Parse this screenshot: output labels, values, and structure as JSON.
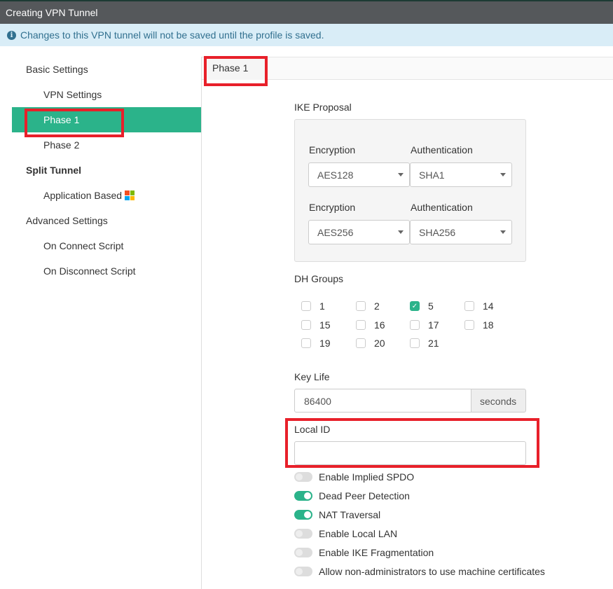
{
  "window": {
    "title": "Creating VPN Tunnel"
  },
  "info": {
    "icon": "info-circle-icon",
    "text": "Changes to this VPN tunnel will not be saved until the profile is saved."
  },
  "nav": {
    "items": [
      {
        "label": "Basic Settings"
      },
      {
        "label": "VPN Settings"
      },
      {
        "label": "Phase 1",
        "active": true
      },
      {
        "label": "Phase 2"
      },
      {
        "label": "Split Tunnel"
      },
      {
        "label": "Application Based"
      },
      {
        "label": "Advanced Settings"
      },
      {
        "label": "On Connect Script"
      },
      {
        "label": "On Disconnect Script"
      }
    ]
  },
  "tab": {
    "label": "Phase 1"
  },
  "ike": {
    "label": "IKE Proposal",
    "rows": [
      {
        "enc_label": "Encryption",
        "enc": "AES128",
        "auth_label": "Authentication",
        "auth": "SHA1"
      },
      {
        "enc_label": "Encryption",
        "enc": "AES256",
        "auth_label": "Authentication",
        "auth": "SHA256"
      }
    ]
  },
  "dh": {
    "label": "DH Groups",
    "groups": [
      {
        "v": "1",
        "c": false
      },
      {
        "v": "2",
        "c": false
      },
      {
        "v": "5",
        "c": true
      },
      {
        "v": "14",
        "c": false
      },
      {
        "v": "15",
        "c": false
      },
      {
        "v": "16",
        "c": false
      },
      {
        "v": "17",
        "c": false
      },
      {
        "v": "18",
        "c": false
      },
      {
        "v": "19",
        "c": false
      },
      {
        "v": "20",
        "c": false
      },
      {
        "v": "21",
        "c": false
      }
    ]
  },
  "keylife": {
    "label": "Key Life",
    "value": "86400",
    "unit": "seconds"
  },
  "localid": {
    "label": "Local ID",
    "value": ""
  },
  "toggles": [
    {
      "label": "Enable Implied SPDO",
      "on": false
    },
    {
      "label": "Dead Peer Detection",
      "on": true
    },
    {
      "label": "NAT Traversal",
      "on": true
    },
    {
      "label": "Enable Local LAN",
      "on": false
    },
    {
      "label": "Enable IKE Fragmentation",
      "on": false
    },
    {
      "label": "Allow non-administrators to use machine certificates",
      "on": false
    }
  ],
  "colors": {
    "accent": "#2bb38a",
    "highlight": "#e8202a",
    "titlebar": "#55585b",
    "info_bg": "#d9edf7"
  }
}
